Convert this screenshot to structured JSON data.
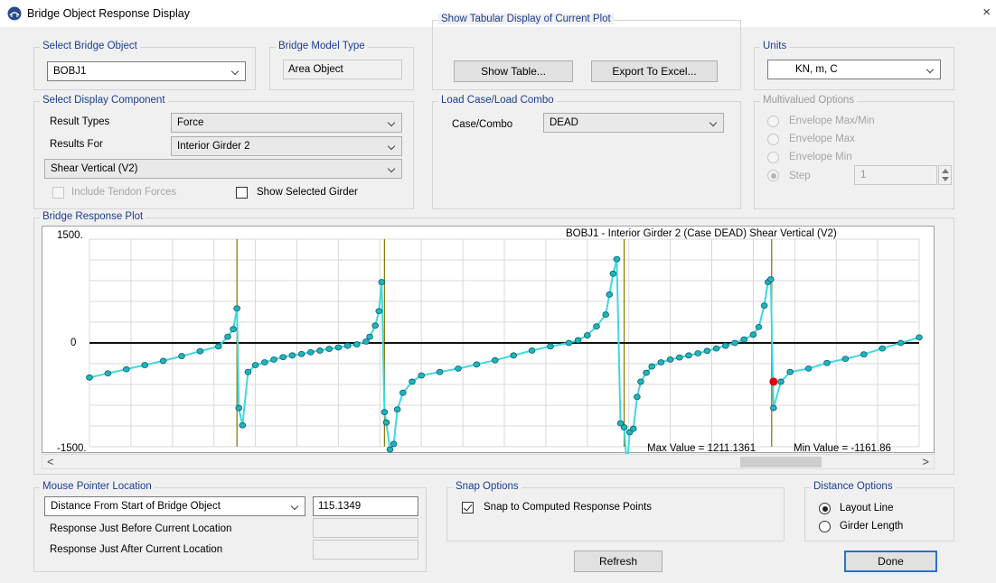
{
  "window": {
    "title": "Bridge Object Response Display",
    "close_glyph": "×"
  },
  "select_bridge_object": {
    "group_label": "Select Bridge Object",
    "value": "BOBJ1"
  },
  "bridge_model_type": {
    "group_label": "Bridge Model Type",
    "value": "Area Object"
  },
  "tabular": {
    "group_label": "Show Tabular Display of Current Plot",
    "show_table": "Show Table...",
    "export_excel": "Export To Excel..."
  },
  "units": {
    "group_label": "Units",
    "value": "KN, m, C"
  },
  "display_component": {
    "group_label": "Select Display Component",
    "result_types_label": "Result Types",
    "result_types_value": "Force",
    "results_for_label": "Results For",
    "results_for_value": "Interior Girder 2",
    "component_value": "Shear Vertical  (V2)",
    "include_tendon_label": "Include Tendon Forces",
    "include_tendon_checked": false,
    "show_selected_girder_label": "Show Selected Girder",
    "show_selected_girder_checked": false
  },
  "load_case": {
    "group_label": "Load Case/Load Combo",
    "case_label": "Case/Combo",
    "case_value": "DEAD"
  },
  "multivalued": {
    "group_label": "Multivalued Options",
    "options": [
      "Envelope Max/Min",
      "Envelope Max",
      "Envelope Min",
      "Step"
    ],
    "selected": "Step",
    "step_value": "1"
  },
  "response_plot": {
    "group_label": "Bridge Response Plot",
    "caption": "BOBJ1 - Interior Girder 2   (Case DEAD)   Shear Vertical  (V2)",
    "max_text": "Max Value = 1211.1361",
    "min_text": "Min Value = -1161.86",
    "scroll_left": "<",
    "scroll_right": ">"
  },
  "chart_data": {
    "type": "line",
    "title": "BOBJ1 - Interior Girder 2   (Case DEAD)   Shear Vertical  (V2)",
    "ylim": [
      -1500,
      1500
    ],
    "y_tick_labels": [
      "1500.",
      "0",
      "-1500."
    ],
    "grid": true,
    "line_color": "#40d8e0",
    "marker_color": "#1fb4bf",
    "support_line_color": "#8a7a10",
    "highlight_point_color": "#e00000",
    "supports_x": [
      8,
      16,
      29,
      37
    ],
    "series": [
      {
        "name": "V2",
        "x": [
          0,
          1,
          2,
          3,
          4,
          5,
          6,
          7,
          7.5,
          7.8,
          8,
          8.1,
          8.3,
          8.6,
          9,
          9.5,
          10,
          10.5,
          11,
          11.5,
          12,
          12.5,
          13,
          13.5,
          14,
          14.5,
          15,
          15.2,
          15.5,
          15.7,
          15.85,
          16,
          16.1,
          16.3,
          16.5,
          16.7,
          17,
          17.5,
          18,
          19,
          20,
          21,
          22,
          23,
          24,
          25,
          26,
          26.5,
          27,
          27.5,
          28,
          28.2,
          28.4,
          28.6,
          28.8,
          29,
          29.15,
          29.3,
          29.5,
          29.7,
          29.9,
          30.2,
          30.5,
          31,
          31.5,
          32,
          32.5,
          33,
          33.5,
          34,
          34.5,
          35,
          35.5,
          36,
          36.3,
          36.6,
          36.8,
          36.95,
          37.1,
          37.5,
          38,
          39,
          40,
          41,
          42,
          43,
          44,
          45
        ],
        "y": [
          -500,
          -440,
          -380,
          -320,
          -260,
          -190,
          -120,
          -50,
          90,
          200,
          500,
          -940,
          -1190,
          -420,
          -320,
          -280,
          -240,
          -205,
          -180,
          -160,
          -135,
          -110,
          -85,
          -65,
          -40,
          -20,
          20,
          90,
          250,
          460,
          880,
          -1000,
          -1150,
          -1540,
          -1460,
          -960,
          -720,
          -560,
          -470,
          -420,
          -370,
          -310,
          -250,
          -180,
          -110,
          -50,
          0,
          40,
          110,
          240,
          410,
          700,
          1000,
          1211,
          -1161,
          -1220,
          -1810,
          -1290,
          -1240,
          -780,
          -560,
          -430,
          -340,
          -280,
          -240,
          -210,
          -180,
          -150,
          -115,
          -80,
          -40,
          0,
          50,
          120,
          230,
          540,
          880,
          920,
          -940,
          -560,
          -420,
          -370,
          -290,
          -230,
          -165,
          -80,
          0,
          80
        ]
      }
    ],
    "highlight_point": {
      "x": 37.1,
      "y": -560
    }
  },
  "mouse_pointer": {
    "group_label": "Mouse Pointer Location",
    "distance_combo": "Distance From Start of Bridge Object",
    "distance_value": "115.1349",
    "before_label": "Response Just Before Current Location",
    "after_label": "Response Just After Current Location",
    "before_value": "",
    "after_value": ""
  },
  "snap": {
    "group_label": "Snap Options",
    "snap_label": "Snap to Computed Response Points",
    "snap_checked": true
  },
  "distance_options": {
    "group_label": "Distance Options",
    "layout_line": "Layout Line",
    "girder_length": "Girder Length",
    "selected": "Layout Line"
  },
  "buttons": {
    "refresh": "Refresh",
    "done": "Done"
  }
}
